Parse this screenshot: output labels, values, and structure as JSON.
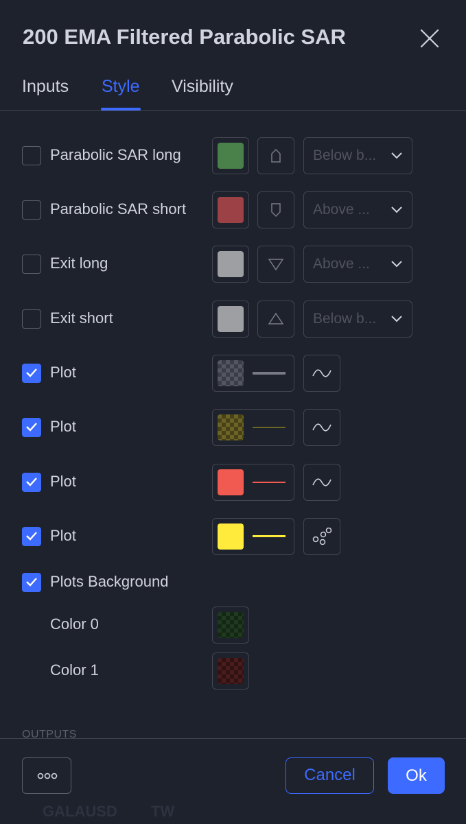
{
  "dialog": {
    "title": "200 EMA Filtered Parabolic SAR",
    "close_icon": "close-icon"
  },
  "tabs": [
    {
      "label": "Inputs",
      "active": false
    },
    {
      "label": "Style",
      "active": true
    },
    {
      "label": "Visibility",
      "active": false
    }
  ],
  "shape_rows": [
    {
      "label": "Parabolic SAR long",
      "checked": false,
      "color": "#4a8049",
      "shape_icon": "arrow-up-shape-icon",
      "location": "Below b..."
    },
    {
      "label": "Parabolic SAR short",
      "checked": false,
      "color": "#9c4246",
      "shape_icon": "arrow-down-shape-icon",
      "location": "Above ..."
    },
    {
      "label": "Exit long",
      "checked": false,
      "color": "#9e9fa3",
      "shape_icon": "triangle-down-icon",
      "location": "Above ..."
    },
    {
      "label": "Exit short",
      "checked": false,
      "color": "#9e9fa3",
      "shape_icon": "triangle-up-icon",
      "location": "Below b..."
    }
  ],
  "plot_rows": [
    {
      "label": "Plot",
      "checked": true,
      "color": "#787b86",
      "transparent": true,
      "style_icon": "line-style-icon"
    },
    {
      "label": "Plot",
      "checked": true,
      "color": "#6b6425",
      "transparent": true,
      "style_icon": "line-style-icon"
    },
    {
      "label": "Plot",
      "checked": true,
      "color": "#f05a50",
      "transparent": false,
      "style_icon": "line-style-icon"
    },
    {
      "label": "Plot",
      "checked": true,
      "color": "#ffeb3b",
      "transparent": false,
      "style_icon": "circles-style-icon"
    }
  ],
  "background": {
    "label": "Plots Background",
    "checked": true,
    "colors": [
      {
        "label": "Color 0",
        "color": "#1f3a1f"
      },
      {
        "label": "Color 1",
        "color": "#4a1c1c"
      }
    ]
  },
  "section_label": "OUTPUTS",
  "footer": {
    "more_icon": "more-options-icon",
    "cancel_label": "Cancel",
    "ok_label": "Ok"
  },
  "background_app": {
    "symbol": "GALAUSD",
    "suffix": "TW"
  },
  "colors": {
    "accent": "#3d6bff",
    "background": "#1e222d",
    "border": "#434651"
  }
}
